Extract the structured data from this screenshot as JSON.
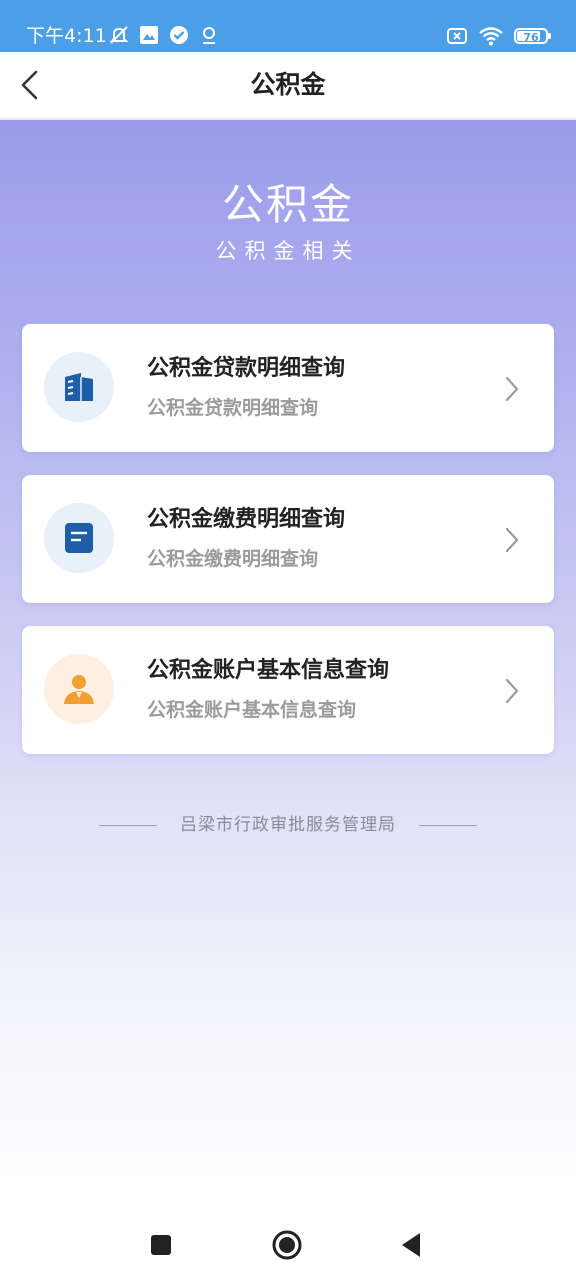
{
  "status_bar": {
    "time": "下午4:11",
    "battery": "76",
    "background_color": "#4a9fe6",
    "left_icons": [
      "notification-muted-icon",
      "gallery-app-icon",
      "verified-check-icon",
      "location-pin-icon"
    ],
    "right_icons": [
      "no-sim-icon",
      "wifi-icon",
      "battery-icon"
    ]
  },
  "nav": {
    "title": "公积金",
    "back_icon": "chevron-left-icon"
  },
  "hero": {
    "title": "公积金",
    "subtitle": "公积金相关"
  },
  "cards": [
    {
      "title": "公积金贷款明细查询",
      "subtitle": "公积金贷款明细查询",
      "icon": "building-icon",
      "icon_bg": "#e8f0fa",
      "icon_color": "#1c5fa8"
    },
    {
      "title": "公积金缴费明细查询",
      "subtitle": "公积金缴费明细查询",
      "icon": "document-icon",
      "icon_bg": "#e8f0fa",
      "icon_color": "#1c5fa8"
    },
    {
      "title": "公积金账户基本信息查询",
      "subtitle": "公积金账户基本信息查询",
      "icon": "person-icon",
      "icon_bg": "#fdf0e2",
      "icon_color": "#f0a030"
    }
  ],
  "footer": {
    "text": "吕梁市行政审批服务管理局"
  },
  "system_nav": {
    "buttons": [
      "recents-square-icon",
      "home-circle-icon",
      "back-triangle-icon"
    ]
  },
  "colors": {
    "gradient_top": "#9c9cea",
    "gradient_bottom": "#ffffff",
    "title_text": "#222222",
    "subtitle_text": "#9b9b9b"
  }
}
